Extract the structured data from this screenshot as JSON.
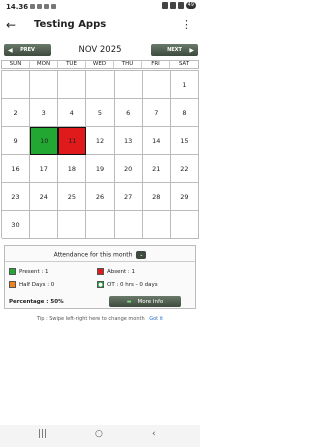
{
  "status_bar": {
    "time": "14.36",
    "battery": "49"
  },
  "app_bar": {
    "title": "Testing Apps",
    "back_icon": "arrow-left-icon",
    "menu_icon": "more-vert-icon"
  },
  "month_nav": {
    "prev_label": "PREV",
    "next_label": "NEXT",
    "month": "NOV 2025"
  },
  "weekdays": [
    "SUN",
    "MON",
    "TUE",
    "WED",
    "THU",
    "FRI",
    "SAT"
  ],
  "calendar": [
    "",
    "",
    "",
    "",
    "",
    "",
    "1",
    "2",
    "3",
    "4",
    "5",
    "6",
    "7",
    "8",
    "9",
    "10",
    "11",
    "12",
    "13",
    "14",
    "15",
    "16",
    "17",
    "18",
    "19",
    "20",
    "21",
    "22",
    "23",
    "24",
    "25",
    "26",
    "27",
    "28",
    "29",
    "30",
    "",
    "",
    "",
    "",
    "",
    ""
  ],
  "marked_days": {
    "present": [
      "10"
    ],
    "absent": [
      "11"
    ]
  },
  "colors": {
    "present": "#22a832",
    "absent": "#e01a1a",
    "half_day": "#f08020",
    "button_dark": "#3d4a3d"
  },
  "attendance": {
    "title": "Attendance for this month",
    "present": "Present : 1",
    "absent": "Absent : 1",
    "half_days": "Half Days : 0",
    "ot": "OT : 0 hrs - 0 days",
    "percentage": "Percentage : 50%",
    "more_info": "More Info"
  },
  "tip": {
    "text": "Tip : Swipe left-right here to change month",
    "got_it": "Got it"
  },
  "nav_bar": {
    "recents": "|||",
    "home": "○",
    "back": "‹"
  }
}
